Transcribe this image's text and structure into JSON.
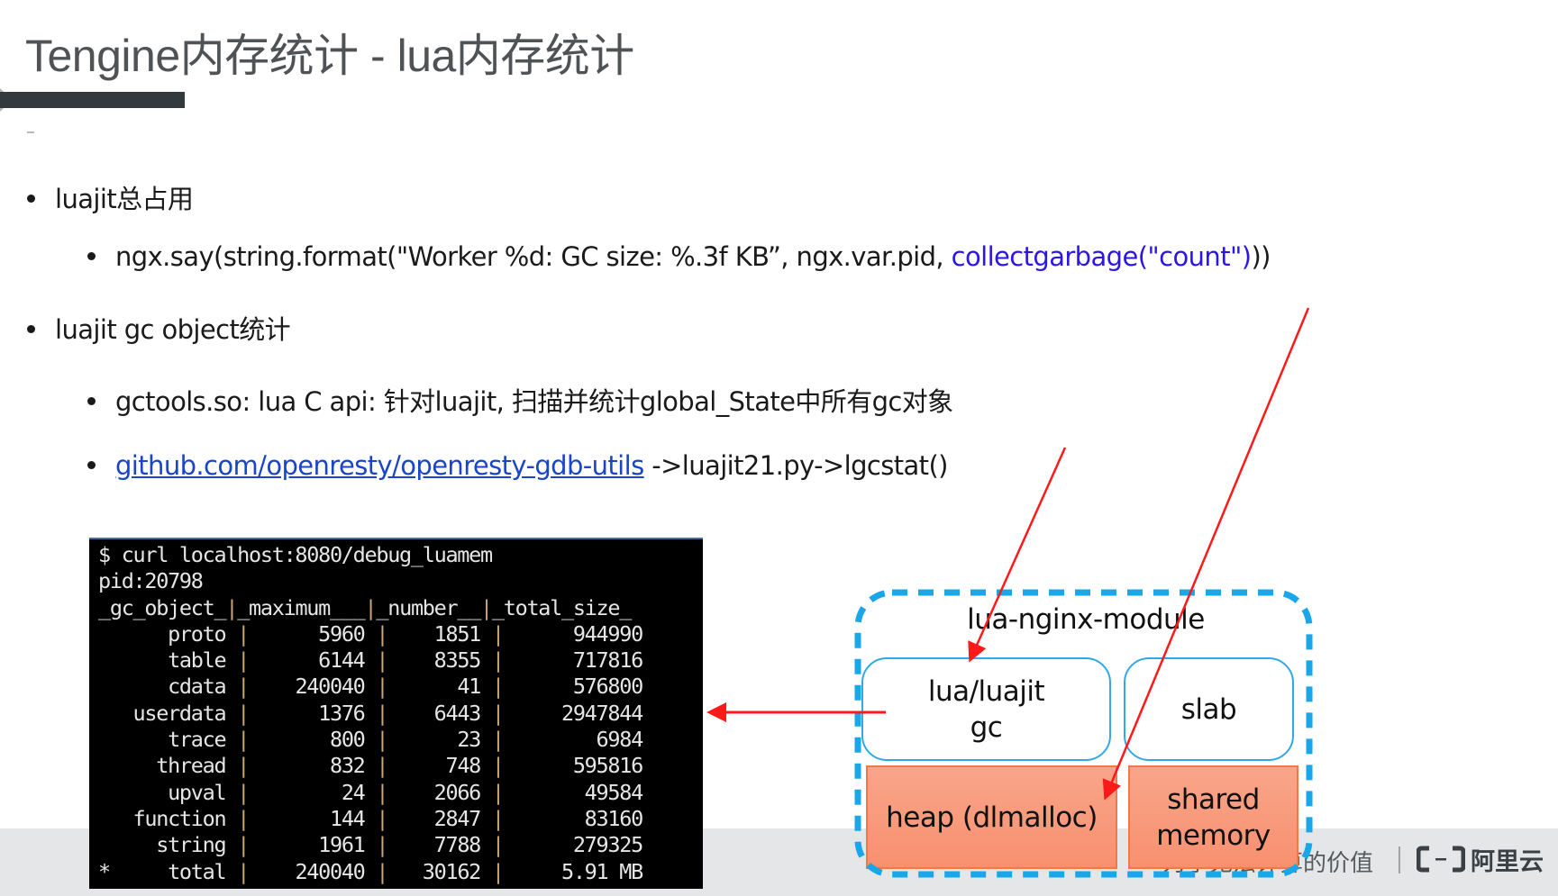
{
  "slide": {
    "title": "Tengine内存统计 - lua内存统计"
  },
  "bullets": [
    {
      "text": "luajit总占用"
    },
    {
      "text": "luajit gc object统计"
    }
  ],
  "sub_bullets": {
    "ngx_say_prefix": "ngx.say(string.format(\"Worker %d: GC size: %.3f KB”, ngx.var.pid, ",
    "ngx_say_highlight": "collectgarbage(\"count\")",
    "ngx_say_suffix": "))",
    "gctools": "gctools.so: lua C api: 针对luajit, 扫描并统计global_State中所有gc对象",
    "github_link": "github.com/openresty/openresty-gdb-utils",
    "github_suffix": " ->luajit21.py->lgcstat()"
  },
  "terminal": {
    "command": "$ curl localhost:8080/debug_luamem",
    "pid_line": "pid:20798",
    "header": [
      "_gc_object_",
      "_maximum___",
      "_number__",
      "_total_size_"
    ],
    "rows": [
      {
        "prefix": " ",
        "name": "proto",
        "maximum": "5960",
        "number": "1851",
        "total_size": "944990"
      },
      {
        "prefix": " ",
        "name": "table",
        "maximum": "6144",
        "number": "8355",
        "total_size": "717816"
      },
      {
        "prefix": " ",
        "name": "cdata",
        "maximum": "240040",
        "number": "41",
        "total_size": "576800"
      },
      {
        "prefix": " ",
        "name": "userdata",
        "maximum": "1376",
        "number": "6443",
        "total_size": "2947844"
      },
      {
        "prefix": " ",
        "name": "trace",
        "maximum": "800",
        "number": "23",
        "total_size": "6984"
      },
      {
        "prefix": " ",
        "name": "thread",
        "maximum": "832",
        "number": "748",
        "total_size": "595816"
      },
      {
        "prefix": " ",
        "name": "upval",
        "maximum": "24",
        "number": "2066",
        "total_size": "49584"
      },
      {
        "prefix": " ",
        "name": "function",
        "maximum": "144",
        "number": "2847",
        "total_size": "83160"
      },
      {
        "prefix": " ",
        "name": "string",
        "maximum": "1961",
        "number": "7788",
        "total_size": "279325"
      },
      {
        "prefix": "*",
        "name": "total",
        "maximum": "240040",
        "number": "30162",
        "total_size": "5.91 MB"
      }
    ]
  },
  "diagram": {
    "module_label": "lua-nginx-module",
    "luajit_gc_line1": "lua/luajit",
    "luajit_gc_line2": "gc",
    "slab": "slab",
    "heap": "heap (dlmalloc)",
    "shared_memory_line1": "shared",
    "shared_memory_line2": "memory",
    "colors": {
      "dashed_border": "#1aa7ea",
      "box_border": "#31a9e6",
      "heap_fill": "#f99b7c",
      "arrow": "#ff1a1a"
    }
  },
  "footer": {
    "slogan": "为了无法计算的价值",
    "brand": "阿里云"
  }
}
